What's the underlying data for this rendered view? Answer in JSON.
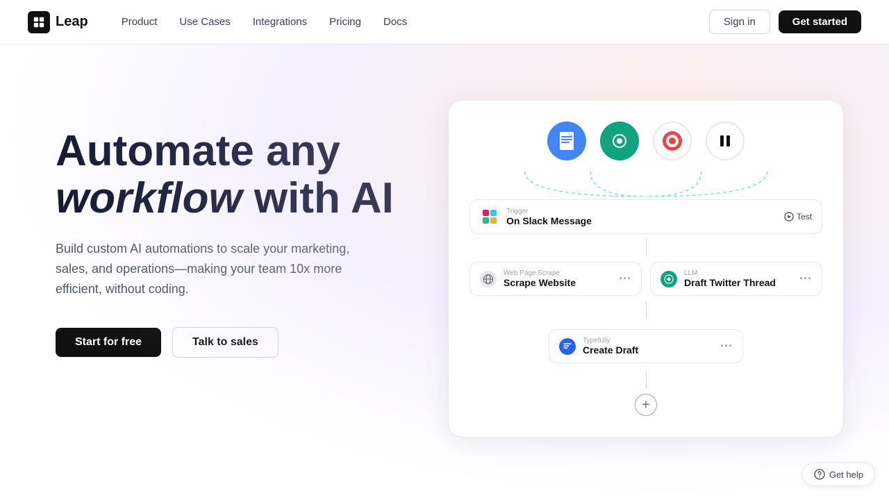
{
  "navbar": {
    "logo_text": "Leap",
    "nav_items": [
      {
        "label": "Product",
        "id": "product"
      },
      {
        "label": "Use Cases",
        "id": "use-cases"
      },
      {
        "label": "Integrations",
        "id": "integrations"
      },
      {
        "label": "Pricing",
        "id": "pricing"
      },
      {
        "label": "Docs",
        "id": "docs"
      }
    ],
    "signin_label": "Sign in",
    "getstarted_label": "Get started"
  },
  "hero": {
    "headline_line1": "Automate any",
    "headline_italic": "workflow",
    "headline_line2": "with AI",
    "subtext": "Build custom AI automations to scale your marketing, sales, and operations—making your team 10x more efficient, without coding.",
    "cta_primary": "Start for free",
    "cta_secondary": "Talk to sales"
  },
  "workflow": {
    "trigger": {
      "label": "Trigger",
      "title": "On Slack Message",
      "test": "Test"
    },
    "node1": {
      "label": "Web Page Scrape",
      "title": "Scrape Website"
    },
    "node2": {
      "label": "LLM",
      "title": "Draft Twitter Thread"
    },
    "node3": {
      "label": "Typefully",
      "title": "Create Draft"
    }
  },
  "get_help": "Get help"
}
